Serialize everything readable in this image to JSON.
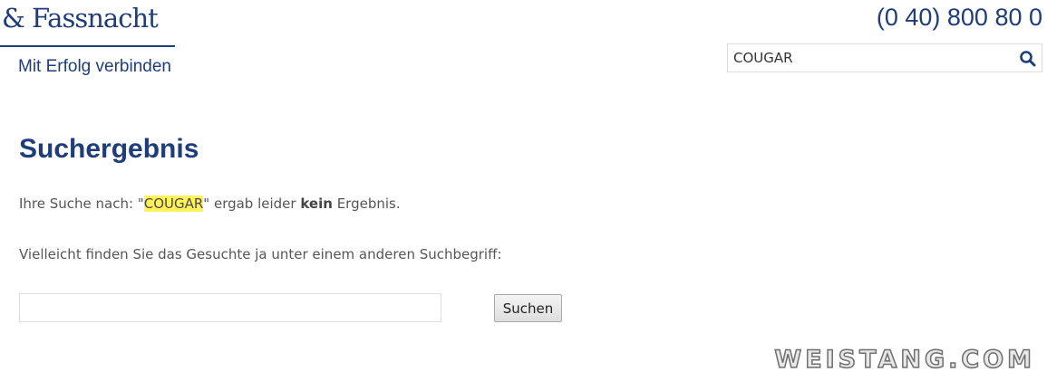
{
  "logo": {
    "name": "& Fassnacht",
    "tagline": "Mit Erfolg verbinden"
  },
  "header": {
    "phone": "(0 40) 800 80 0",
    "search": {
      "value": "COUGAR",
      "icon": "search-icon"
    }
  },
  "main": {
    "title": "Suchergebnis",
    "result": {
      "prefix": "Ihre Suche nach: \"",
      "query": "COUGAR",
      "middle": "\" ergab leider ",
      "emphasis": "kein",
      "suffix": " Ergebnis."
    },
    "suggestion": "Vielleicht finden Sie das Gesuchte ja unter einem anderen Suchbegriff:",
    "search_field_value": "",
    "search_button": "Suchen"
  },
  "watermark": "WEISTANG.COM",
  "colors": {
    "brand": "#1f3d7a",
    "highlight": "#fff25a",
    "text": "#555555"
  }
}
